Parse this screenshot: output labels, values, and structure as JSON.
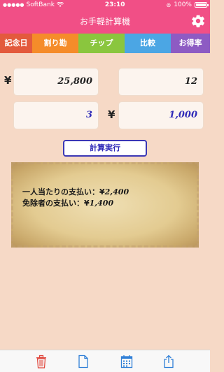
{
  "status": {
    "carrier": "SoftBank",
    "time": "23:10",
    "battery": "100%"
  },
  "nav": {
    "title": "お手軽計算機"
  },
  "tabs": [
    "記念日",
    "割り勘",
    "チップ",
    "比較",
    "お得率"
  ],
  "inputs": {
    "currency_symbol": "¥",
    "total_amount": "25,800",
    "people_count": "12",
    "exempt_count": "3",
    "exempt_amount": "1,000"
  },
  "calc_button": "計算実行",
  "results": {
    "per_person_label": "一人当たりの支払い：¥",
    "per_person_amount": "2,400",
    "exempt_label": "免除者の支払い：¥",
    "exempt_amount": "1,400"
  },
  "toolbar_icons": [
    "trash-icon",
    "document-icon",
    "calendar-icon",
    "share-icon"
  ],
  "colors": {
    "accent": "#f14f86",
    "tab_colors": [
      "#e35a3d",
      "#f58c2a",
      "#8ac63e",
      "#4ba6e4",
      "#8d5bc3"
    ],
    "toolbar_icon": "#2f7fd7",
    "trash_icon": "#e0463c"
  }
}
